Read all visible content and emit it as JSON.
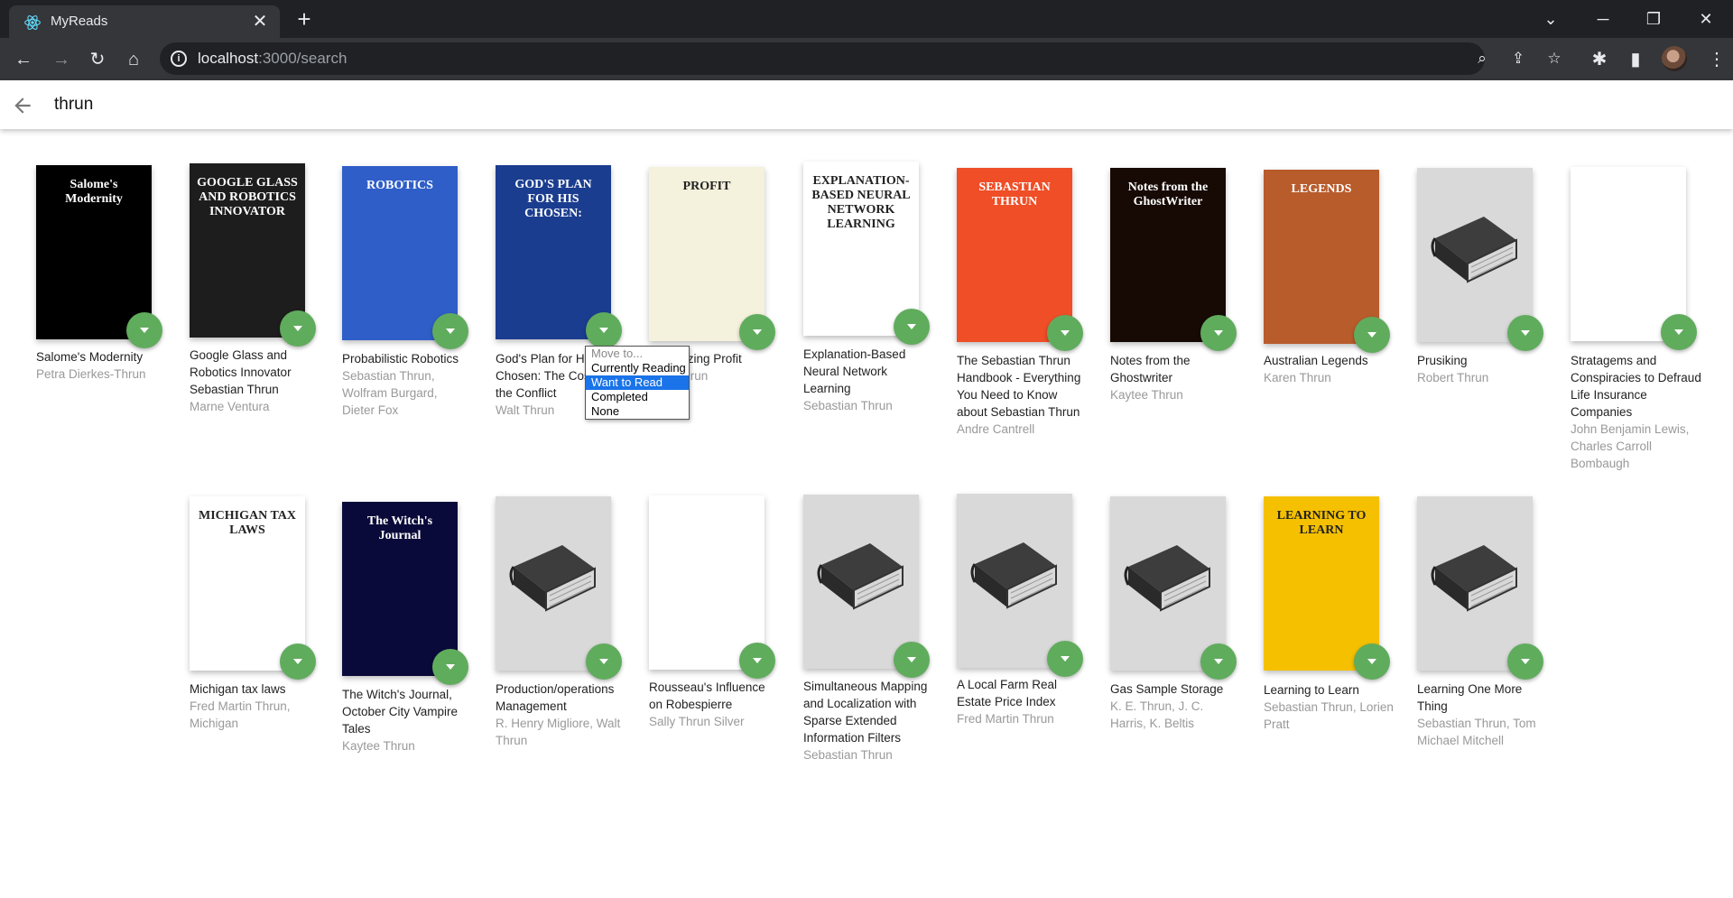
{
  "browser": {
    "tab_title": "MyReads",
    "url_host": "localhost",
    "url_path": ":3000/search"
  },
  "search": {
    "query": "thrun"
  },
  "dropdown": {
    "options": [
      "Move to...",
      "Currently Reading",
      "Want to Read",
      "Completed",
      "None"
    ],
    "selected": "Want to Read"
  },
  "books": [
    {
      "title": "Salome's Modernity",
      "authors": "Petra Dierkes-Thrun",
      "cover_bg": "#000000",
      "cover_text": "Salome's Modernity"
    },
    {
      "title": "Google Glass and Robotics Innovator Sebastian Thrun",
      "authors": "Marne Ventura",
      "cover_bg": "#1d1d1d",
      "cover_text": "GOOGLE GLASS AND ROBOTICS INNOVATOR"
    },
    {
      "title": "Probabilistic Robotics",
      "authors": "Sebastian Thrun, Wolfram Burgard, Dieter Fox",
      "cover_bg": "#2f5ec8",
      "cover_text": "ROBOTICS"
    },
    {
      "title": "God's Plan for His Chosen: The Cost and the Conflict",
      "authors": "Walt Thrun",
      "cover_bg": "#1b3d8f",
      "cover_text": "GOD'S PLAN FOR HIS CHOSEN:"
    },
    {
      "title": "Maximizing Profit",
      "authors": "Walt Thrun",
      "cover_bg": "#f4f1dc",
      "cover_text": "PROFIT"
    },
    {
      "title": "Explanation-Based Neural Network Learning",
      "authors": "Sebastian Thrun",
      "cover_bg": "#ffffff",
      "cover_text": "EXPLANATION-BASED NEURAL NETWORK LEARNING"
    },
    {
      "title": "The Sebastian Thrun Handbook - Everything You Need to Know about Sebastian Thrun",
      "authors": "Andre Cantrell",
      "cover_bg": "#ef4e27",
      "cover_text": "SEBASTIAN THRUN"
    },
    {
      "title": "Notes from the Ghostwriter",
      "authors": "Kaytee Thrun",
      "cover_bg": "#170a05",
      "cover_text": "Notes from the GhostWriter"
    },
    {
      "title": "Australian Legends",
      "authors": "Karen Thrun",
      "cover_bg": "#b85c2c",
      "cover_text": "LEGENDS"
    },
    {
      "title": "Prusiking",
      "authors": "Robert Thrun",
      "cover_bg": "#d9d9d9",
      "cover_text": ""
    },
    {
      "title": "Stratagems and Conspiracies to Defraud Life Insurance Companies",
      "authors": "John Benjamin Lewis, Charles Carroll Bombaugh",
      "cover_bg": "#ffffff",
      "cover_text": ""
    },
    {
      "title": "Michigan tax laws",
      "authors": "Fred Martin Thrun, Michigan",
      "cover_bg": "#ffffff",
      "cover_text": "MICHIGAN TAX LAWS"
    },
    {
      "title": "The Witch's Journal, October City Vampire Tales",
      "authors": "Kaytee Thrun",
      "cover_bg": "#0a0a3a",
      "cover_text": "The Witch's Journal"
    },
    {
      "title": "Production/operations Management",
      "authors": "R. Henry Migliore, Walt Thrun",
      "cover_bg": "#d9d9d9",
      "cover_text": ""
    },
    {
      "title": "Rousseau's Influence on Robespierre",
      "authors": "Sally Thrun Silver",
      "cover_bg": "#ffffff",
      "cover_text": ""
    },
    {
      "title": "Simultaneous Mapping and Localization with Sparse Extended Information Filters",
      "authors": "Sebastian Thrun",
      "cover_bg": "#d9d9d9",
      "cover_text": ""
    },
    {
      "title": "A Local Farm Real Estate Price Index",
      "authors": "Fred Martin Thrun",
      "cover_bg": "#d9d9d9",
      "cover_text": ""
    },
    {
      "title": "Gas Sample Storage",
      "authors": "K. E. Thrun, J. C. Harris, K. Beltis",
      "cover_bg": "#d9d9d9",
      "cover_text": ""
    },
    {
      "title": "Learning to Learn",
      "authors": "Sebastian Thrun, Lorien Pratt",
      "cover_bg": "#f5c000",
      "cover_text": "LEARNING TO LEARN"
    },
    {
      "title": "Learning One More Thing",
      "authors": "Sebastian Thrun, Tom Michael Mitchell",
      "cover_bg": "#d9d9d9",
      "cover_text": ""
    }
  ]
}
